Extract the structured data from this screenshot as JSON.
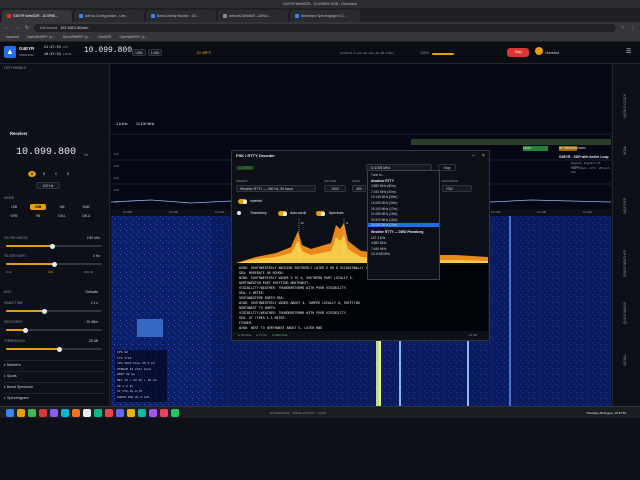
{
  "browser": {
    "title": "G4EYR WebSDR - 10.099800 USB - Chromium",
    "tabs": [
      "G4EYR WebSDR - 10.0998...",
      "AdHoc Configuration - Use...",
      "Band Activity Monitor - G4...",
      "websdr24b0d665 - AdHoc...",
      "Wideband Spectrograph 0-3..."
    ],
    "url": "192.168.0.80/sdr/",
    "security": "Not secure",
    "bookmarks": [
      "Imported",
      "OpenWebRX+ (s...",
      "OpenWebRX+ (s...",
      "KiwiSDR",
      "OpenWebRX+ (s..."
    ]
  },
  "header": {
    "callsign": "G4EYR",
    "subtitle": "UBERSDR",
    "utc_time": "21:37:54",
    "utc_label": "UTC",
    "local_time": "16:37:54",
    "local_label": "LOCAL",
    "freq": "10.099.800",
    "mode": "USB",
    "bw": "1.00k",
    "signal": "-92 dBFS",
    "smeter": "S-UNITS: 9 +10 +20 +30 +40  -85.2 dBm",
    "pct": "100%",
    "stop_label": "Stop",
    "unmuted": "Unmuted",
    "menu_icon": "hamburger-icon"
  },
  "left": {
    "panel_title": "LEFT PANELS",
    "receiver_title": "Receiver",
    "freq": "10.099.800",
    "freq_unit": "Hz",
    "vfo": [
      "A",
      "B",
      "C",
      "D"
    ],
    "step_label": "100 Hz",
    "mode_title": "MODE",
    "modes": [
      "LSB",
      "USB",
      "AM",
      "SAM",
      "NFM",
      "FM",
      "CW-L",
      "CW-U"
    ],
    "active_mode": "USB",
    "filter_width_label": "FILTER WIDTH",
    "filter_width_val": "2.80 kHz",
    "filter_shift_label": "FILTER SHIFT",
    "filter_shift_val": "0 Hz",
    "filter_lo": "0 42",
    "filter_mid": "100",
    "filter_hi": "300 42",
    "agc_label": "AGC",
    "agc_val": "Defaults",
    "hang_label": "HANG TIME",
    "hang_val": "1.1 s",
    "recovery_label": "RECOVERY",
    "recovery_val": "20 dB/s",
    "threshold_label": "THRESHOLD",
    "threshold_val": "-25 dB",
    "sections": [
      "Markers",
      "Spots",
      "Band Spectrum",
      "Spectrogram"
    ]
  },
  "main": {
    "spectrum_labels": [
      "-110",
      "-120",
      "-130",
      "-140",
      "-150"
    ],
    "freq_marker_1": "10.100 MHz",
    "freq_marker_1b": "-1.8 kHz",
    "station_title": "G4EYR - SDR with Active Loop",
    "station_sub": "Brighton, England, UK (IO90...)",
    "station_weather": "Few Clouds · 13°C · 28 km/h SW",
    "mini_tag": "OKAY",
    "mini_time": "HF PROPAGATION",
    "freq_scale": [
      "10.090",
      "10.092",
      "10.094",
      "10.096",
      "10.098",
      "10.100",
      "10.102",
      "10.104",
      "10.106",
      "10.108",
      "10.110"
    ],
    "info_box": [
      "FPS   60",
      "FT8   5/24",
      "CPU   2048 kbps 56.6 kb",
      "STREAM  12 kbit mono",
      "HOST  38 ms",
      "NET   13 + 39 kb + 16 ms",
      "UP    1 d 2h",
      "IP    172.16.0.75",
      "AUDIO  256 Hz 2 kHz"
    ]
  },
  "dialog": {
    "title": "FSK / RTTY Decoder",
    "status_badge": "CLOSED",
    "preset_label": "PRESET",
    "preset_val": "Weather RTTY — 450 Hz, 50 baud",
    "center_label": "CENTER",
    "center_val": "1000",
    "shift_label": "SHIFT",
    "shift_val": "450",
    "encoding_label": "ENCODING",
    "encoding_val": "ITA2",
    "inverted_label": "Inverted",
    "timestamp_label": "Timestamp",
    "autoscroll_label": "Auto-scroll",
    "spectrum_label": "Spectrum",
    "tuner_val": "10.1008 MHz",
    "stop_label": "Stop",
    "mark_label": "M",
    "space_label": "S",
    "text_lines": [
      "WIND: SOUTHWESTERLY BACKING SOUTHERLY LATER 5 OR 6 OCCASIONALLY 7 LATER.",
      "SEA: MODERATE OR ROUGH.",
      "WIND: SOUTHWESTERLY WINDS 3 TO 4, SOUTHERN PART LOCALLY 5.",
      "NORTHWESTON PART SHIFTING NORTHWEST.",
      "VISIBILITY/WEATHER: THUNDERSTORMS WITH POOR VISIBILITY.",
      "SEA: 1 METER.",
      "SOUTHWESTERN NORTH SEA:",
      "WIND: SOUTHWESTERLY WINDS ABOUT 4, TAMPED LOCALLY 6, SHIFTING",
      "NORTHWEST TO NORTH.",
      "VISIBILITY/WEATHER: THUNDERSTORMS WITH POOR VISIBILITY.",
      "SEA: AT TIMES 1.5 METER.",
      "FISHER:",
      "WIND: WEST TO NORTHWEST ABOUT 5, LATER NNE"
    ],
    "footer": [
      "SIGNAL",
      "SYNC",
      "DECODE"
    ],
    "footer_db": "-15 dB"
  },
  "dropdown": {
    "first": "Tune to...",
    "group1": "Amateur RTTY",
    "items1": [
      "3.580 MHz (80m)",
      "7.040 MHz (40m)",
      "10.140 MHz (30m)",
      "14.080 MHz (20m)",
      "18.100 MHz (17m)",
      "21.080 MHz (15m)",
      "24.920 MHz (12m)",
      "28.080 MHz (10m)"
    ],
    "group2": "Weather RTTY — DWD Pinneberg",
    "items2": [
      "147.3 kHz",
      "4.583 MHz",
      "7.646 MHz",
      "10.1008 MHz"
    ]
  },
  "rightrail": [
    "SIGNAL",
    "QUICK BANDS",
    "SPACE WEATHER",
    "WEATHER",
    "NOAA",
    "WORLD CLOCK"
  ],
  "taskbar": {
    "center": "EXTENSIONS · VOICE ACTIVITY · CHAT",
    "clock": "Thursday 28 August, 16:37:54"
  },
  "colors": {
    "accent": "#e3a008",
    "danger": "#da3633",
    "waterfall_bg": "#0a1a5c"
  }
}
